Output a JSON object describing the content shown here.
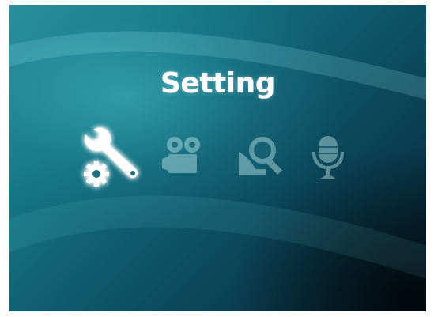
{
  "screen": {
    "title": "Setting"
  },
  "menu": {
    "items": [
      {
        "icon": "settings-wrench-gear-icon",
        "selected": true
      },
      {
        "icon": "video-camera-icon",
        "selected": false
      },
      {
        "icon": "playback-review-magnifier-icon",
        "selected": false
      },
      {
        "icon": "voice-recorder-microphone-icon",
        "selected": false
      }
    ]
  },
  "colors": {
    "background_light": "#2a8f9f",
    "background_dark": "#061d2a",
    "selected_icon": "#ffffff",
    "glow": "#8ff3ff"
  }
}
